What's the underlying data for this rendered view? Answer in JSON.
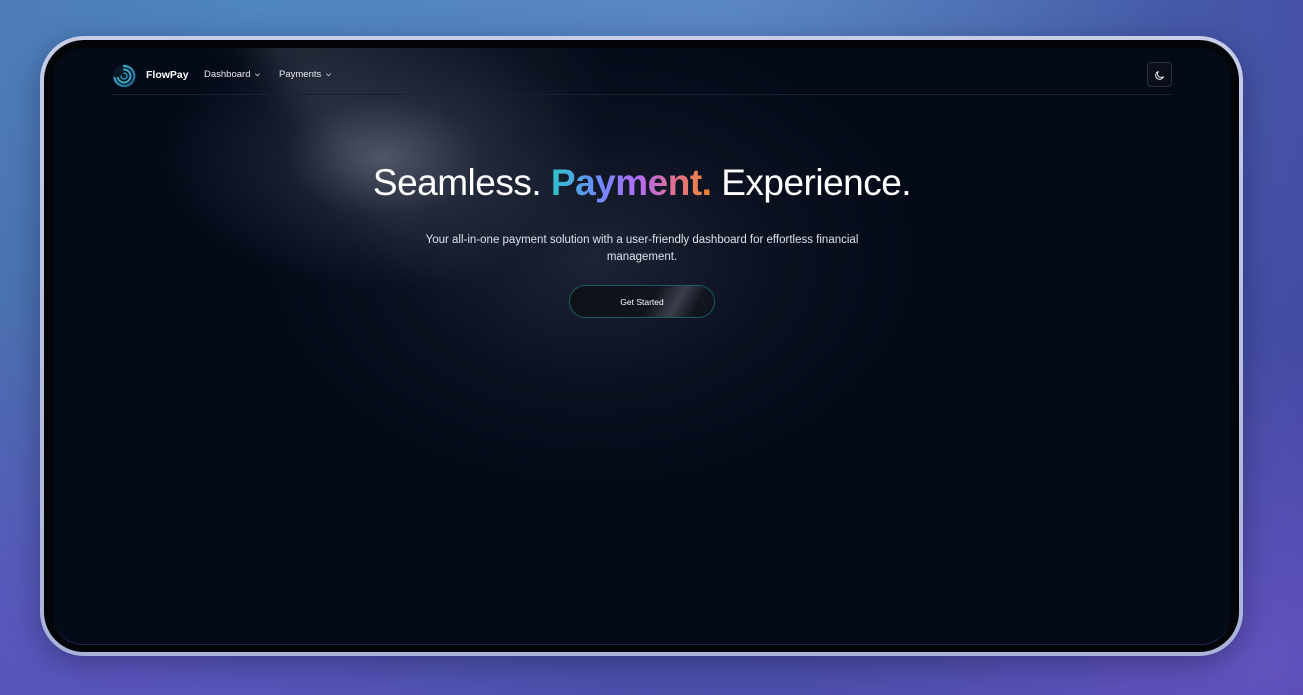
{
  "brand": {
    "name": "FlowPay",
    "logo_icon": "swirl-logo-icon"
  },
  "nav": {
    "items": [
      {
        "label": "Dashboard",
        "icon": "chevron-down-icon"
      },
      {
        "label": "Payments",
        "icon": "chevron-down-icon"
      }
    ],
    "theme_toggle_icon": "moon-icon"
  },
  "hero": {
    "title_part1": "Seamless. ",
    "title_accent": "Payment.",
    "title_part2": " Experience.",
    "subtitle": "Your all-in-one payment solution with a user-friendly dashboard for effortless financial management.",
    "cta_label": "Get Started"
  },
  "colors": {
    "screen_bg": "#040a18",
    "accent_gradient": [
      "#2fc2c8",
      "#6f8bff",
      "#b36bf0",
      "#e0708c",
      "#f08a2a"
    ],
    "cta_border": "#1c5b5e"
  }
}
